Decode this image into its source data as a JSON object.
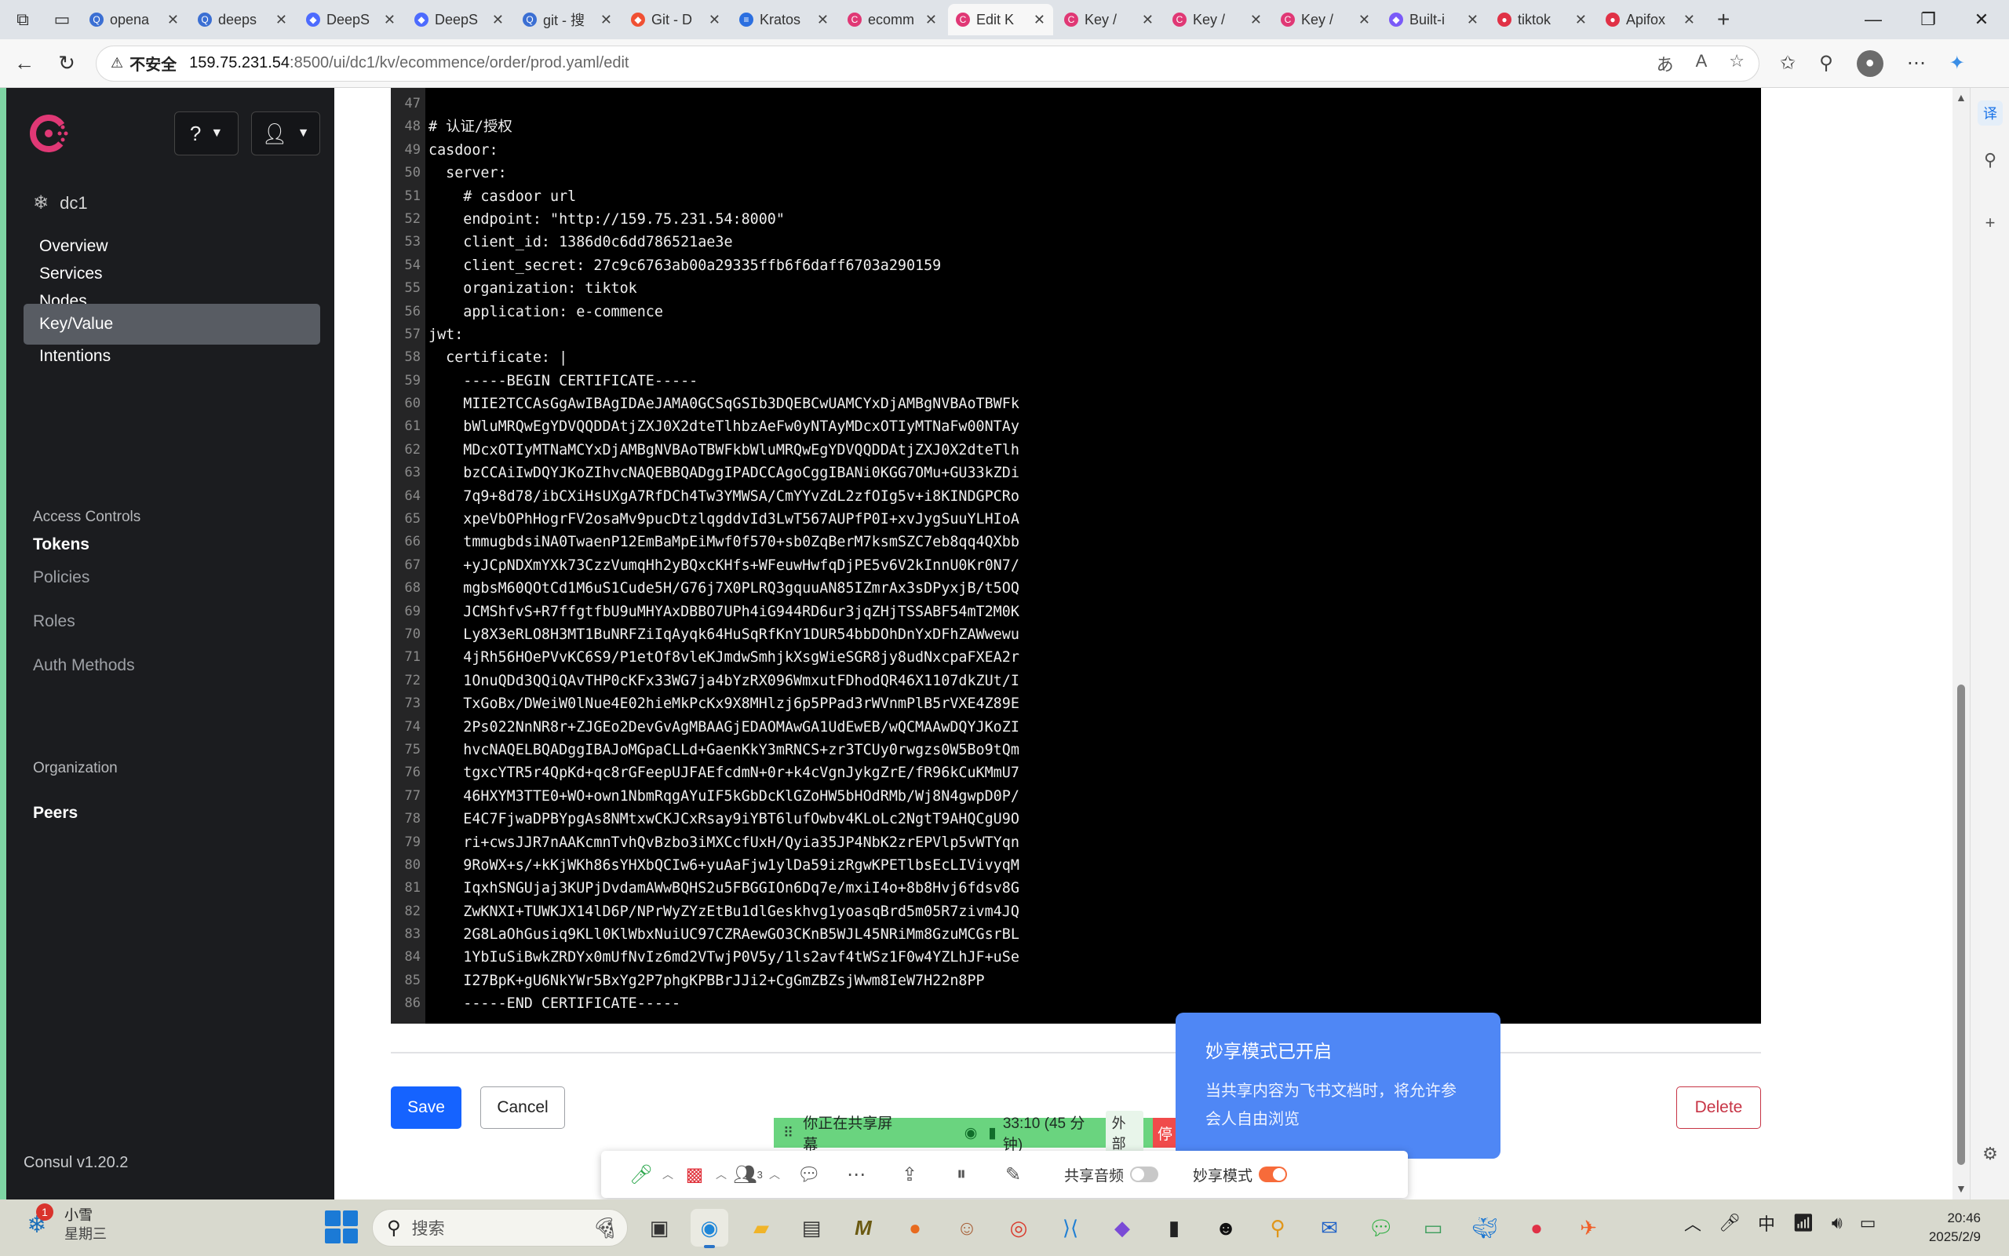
{
  "browser": {
    "tabs": [
      {
        "label": "opena",
        "fav": "Q",
        "color": "#3b6fd3"
      },
      {
        "label": "deeps",
        "fav": "Q",
        "color": "#3b6fd3"
      },
      {
        "label": "DeepS",
        "fav": "◆",
        "color": "#4d6bfe"
      },
      {
        "label": "DeepS",
        "fav": "◆",
        "color": "#4d6bfe"
      },
      {
        "label": "git - 搜",
        "fav": "Q",
        "color": "#3b6fd3"
      },
      {
        "label": "Git - D",
        "fav": "◆",
        "color": "#f05033"
      },
      {
        "label": "Kratos",
        "fav": "≡",
        "color": "#2b6fe0"
      },
      {
        "label": "ecomm",
        "fav": "C",
        "color": "#e03875"
      },
      {
        "label": "Edit K",
        "fav": "C",
        "color": "#e03875"
      },
      {
        "label": "Key /",
        "fav": "C",
        "color": "#e03875"
      },
      {
        "label": "Key /",
        "fav": "C",
        "color": "#e03875"
      },
      {
        "label": "Key /",
        "fav": "C",
        "color": "#e03875"
      },
      {
        "label": "Built-i",
        "fav": "◆",
        "color": "#7a5af8"
      },
      {
        "label": "tiktok",
        "fav": "●",
        "color": "#e03146"
      },
      {
        "label": "Apifox",
        "fav": "●",
        "color": "#e03146"
      }
    ],
    "active_tab": 8,
    "insecure_label": "不安全",
    "url_host": "159.75.231.54",
    "url_rest": ":8500/ui/dc1/kv/ecommence/order/prod.yaml/edit"
  },
  "sidebar": {
    "datacenter": "dc1",
    "nav": [
      "Overview",
      "Services",
      "Nodes",
      "Key/Value",
      "Intentions"
    ],
    "active": "Key/Value",
    "access_heading": "Access Controls",
    "tokens": "Tokens",
    "policies": "Policies",
    "roles": "Roles",
    "auth_methods": "Auth Methods",
    "org_heading": "Organization",
    "peers": "Peers",
    "version": "Consul v1.20.2"
  },
  "editor": {
    "lines": [
      {
        "n": "47",
        "t": ""
      },
      {
        "n": "48",
        "t": "# 认证/授权"
      },
      {
        "n": "49",
        "t": "casdoor:"
      },
      {
        "n": "50",
        "t": "  server:"
      },
      {
        "n": "51",
        "t": "    # casdoor url"
      },
      {
        "n": "52",
        "t": "    endpoint: \"http://159.75.231.54:8000\""
      },
      {
        "n": "53",
        "t": "    client_id: 1386d0c6dd786521ae3e"
      },
      {
        "n": "54",
        "t": "    client_secret: 27c9c6763ab00a29335ffb6f6daff6703a290159"
      },
      {
        "n": "55",
        "t": "    organization: tiktok"
      },
      {
        "n": "56",
        "t": "    application: e-commence"
      },
      {
        "n": "57",
        "t": "jwt:"
      },
      {
        "n": "58",
        "t": "  certificate: |"
      },
      {
        "n": "59",
        "t": "    -----BEGIN CERTIFICATE-----"
      },
      {
        "n": "60",
        "t": "    MIIE2TCCAsGgAwIBAgIDAeJAMA0GCSqGSIb3DQEBCwUAMCYxDjAMBgNVBAoTBWFk"
      },
      {
        "n": "61",
        "t": "    bWluMRQwEgYDVQQDDAtjZXJ0X2dteTlhbzAeFw0yNTAyMDcxOTIyMTNaFw00NTAy"
      },
      {
        "n": "62",
        "t": "    MDcxOTIyMTNaMCYxDjAMBgNVBAoTBWFkbWluMRQwEgYDVQQDDAtjZXJ0X2dteTlh"
      },
      {
        "n": "63",
        "t": "    bzCCAiIwDQYJKoZIhvcNAQEBBQADggIPADCCAgoCggIBANi0KGG7OMu+GU33kZDi"
      },
      {
        "n": "64",
        "t": "    7q9+8d78/ibCXiHsUXgA7RfDCh4Tw3YMWSA/CmYYvZdL2zfOIg5v+i8KINDGPCRo"
      },
      {
        "n": "65",
        "t": "    xpeVbOPhHogrFV2osaMv9pucDtzlqgddvId3LwT567AUPfP0I+xvJygSuuYLHIoA"
      },
      {
        "n": "66",
        "t": "    tmmugbdsiNA0TwaenP12EmBaMpEiMwf0f570+sb0ZqBerM7ksmSZC7eb8qq4QXbb"
      },
      {
        "n": "67",
        "t": "    +yJCpNDXmYXk73CzzVumqHh2yBQxcKHfs+WFeuwHwfqDjPE5v6V2kInnU0Kr0N7/"
      },
      {
        "n": "68",
        "t": "    mgbsM60QOtCd1M6uS1Cude5H/G76j7X0PLRQ3gquuAN85IZmrAx3sDPyxjB/t5OQ"
      },
      {
        "n": "69",
        "t": "    JCMShfvS+R7ffgtfbU9uMHYAxDBBO7UPh4iG944RD6ur3jqZHjTSSABF54mT2M0K"
      },
      {
        "n": "70",
        "t": "    Ly8X3eRLO8H3MT1BuNRFZiIqAyqk64HuSqRfKnY1DUR54bbDOhDnYxDFhZAWwewu"
      },
      {
        "n": "71",
        "t": "    4jRh56HOePVvKC6S9/P1etOf8vleKJmdwSmhjkXsgWieSGR8jy8udNxcpaFXEA2r"
      },
      {
        "n": "72",
        "t": "    1OnuQDd3QQiQAvTHP0cKFx33WG7ja4bYzRX096WmxutFDhodQR46X1107dkZUt/I"
      },
      {
        "n": "73",
        "t": "    TxGoBx/DWeiW0lNue4E02hieMkPcKx9X8MHlzj6p5PPad3rWVnmPlB5rVXE4Z89E"
      },
      {
        "n": "74",
        "t": "    2Ps022NnNR8r+ZJGEo2DevGvAgMBAAGjEDAOMAwGA1UdEwEB/wQCMAAwDQYJKoZI"
      },
      {
        "n": "75",
        "t": "    hvcNAQELBQADggIBAJoMGpaCLLd+GaenKkY3mRNCS+zr3TCUy0rwgzs0W5Bo9tQm"
      },
      {
        "n": "76",
        "t": "    tgxcYTR5r4QpKd+qc8rGFeepUJFAEfcdmN+0r+k4cVgnJykgZrE/fR96kCuKMmU7"
      },
      {
        "n": "77",
        "t": "    46HXYM3TTE0+WO+own1NbmRqgAYuIF5kGbDcKlGZoHW5bHOdRMb/Wj8N4gwpD0P/"
      },
      {
        "n": "78",
        "t": "    E4C7FjwaDPBYpgAs8NMtxwCKJCxRsay9iYBT6lufOwbv4KLoLc2NgtT9AHQCgU9O"
      },
      {
        "n": "79",
        "t": "    ri+cwsJJR7nAAKcmnTvhQvBzbo3iMXCcfUxH/Qyia35JP4NbK2zrEPVlp5vWTYqn"
      },
      {
        "n": "80",
        "t": "    9RoWX+s/+kKjWKh86sYHXbQCIw6+yuAaFjw1ylDa59izRgwKPETlbsEcLIVivyqM"
      },
      {
        "n": "81",
        "t": "    IqxhSNGUjaj3KUPjDvdamAWwBQHS2u5FBGGIOn6Dq7e/mxiI4o+8b8Hvj6fdsv8G"
      },
      {
        "n": "82",
        "t": "    ZwKNXI+TUWKJX14lD6P/NPrWyZYzEtBu1dlGeskhvg1yoasqBrd5m05R7zivm4JQ"
      },
      {
        "n": "83",
        "t": "    2G8LaOhGusiq9KLl0KlWbxNuiUC97CZRAewGO3CKnB5WJL45NRiMm8GzuMCGsrBL"
      },
      {
        "n": "84",
        "t": "    1YbIuSiBwkZRDYx0mUfNvIz6md2VTwjP0V5y/1ls2avf4tWSz1F0w4YZLhJF+uSe"
      },
      {
        "n": "85",
        "t": "    I27BpK+gU6NkYWr5BxYg2P7phgKPBBrJJi2+CgGmZBZsjWwm8IeW7H22n8PP"
      },
      {
        "n": "86",
        "t": "    -----END CERTIFICATE-----"
      }
    ]
  },
  "actions": {
    "save": "Save",
    "cancel": "Cancel",
    "delete": "Delete"
  },
  "share": {
    "popover_title": "妙享模式已开启",
    "popover_body": "当共享内容为飞书文档时，将允许参会人自由浏览",
    "sharing_label": "你正在共享屏幕",
    "timer": "33:10 (45 分钟)",
    "external": "外部",
    "stop": "停",
    "participants": "3",
    "audio_label": "共享音频",
    "mode_label": "妙享模式"
  },
  "taskbar": {
    "weather_name": "小雪",
    "weather_day": "星期三",
    "weather_badge": "1",
    "search_placeholder": "搜索",
    "ime": "中",
    "time": "20:46",
    "date": "2025/2/9"
  }
}
